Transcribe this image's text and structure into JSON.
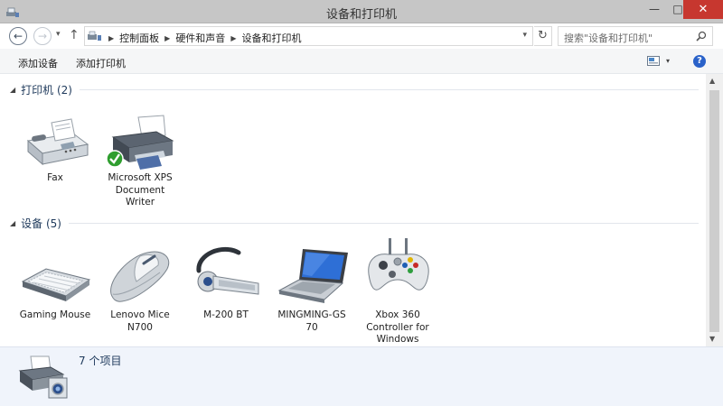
{
  "window": {
    "title": "设备和打印机",
    "minimize_glyph": "—",
    "maximize_glyph": "□",
    "close_glyph": "✕"
  },
  "navigation": {
    "back_glyph": "←",
    "forward_glyph": "→",
    "recent_glyph": "▾",
    "up_glyph": "↑",
    "refresh_glyph": "↻"
  },
  "address": {
    "crumbs": [
      "控制面板",
      "硬件和声音",
      "设备和打印机"
    ],
    "separator": "▶"
  },
  "search": {
    "placeholder": "搜索\"设备和打印机\""
  },
  "command_bar": {
    "add_device": "添加设备",
    "add_printer": "添加打印机",
    "help_glyph": "?"
  },
  "groups": {
    "printers": {
      "label": "打印机 (2)",
      "items": [
        {
          "label": "Fax",
          "icon": "fax-icon"
        },
        {
          "label": "Microsoft XPS Document Writer",
          "icon": "printer-default-icon"
        }
      ]
    },
    "devices": {
      "label": "设备 (5)",
      "items": [
        {
          "label": "Gaming Mouse",
          "icon": "keyboard-icon"
        },
        {
          "label": "Lenovo Mice N700",
          "icon": "mouse-icon"
        },
        {
          "label": "M-200 BT",
          "icon": "headset-icon"
        },
        {
          "label": "MINGMING-GS 70",
          "icon": "laptop-icon"
        },
        {
          "label": "Xbox 360 Controller for Windows",
          "icon": "gamepad-icon"
        }
      ]
    }
  },
  "details": {
    "count": "7 个项目",
    "icon": "devices-printers-icon"
  },
  "colors": {
    "titlebar": "#c6c6c6",
    "close_button": "#c7372f",
    "group_header": "#1e395b",
    "details_pane": "#f0f4fb",
    "help": "#2a62c9",
    "check": "#2f9e2f"
  }
}
